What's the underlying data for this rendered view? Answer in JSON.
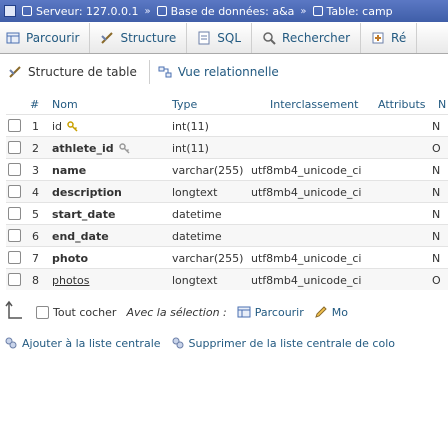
{
  "breadcrumb": {
    "server": "Serveur: 127.0.0.1",
    "database": "Base de données: a&a",
    "table": "Table: camp"
  },
  "tabs": [
    {
      "label": "Parcourir"
    },
    {
      "label": "Structure"
    },
    {
      "label": "SQL"
    },
    {
      "label": "Rechercher"
    },
    {
      "label": "Ré"
    }
  ],
  "subtabs": {
    "structure": "Structure de table",
    "relational": "Vue relationnelle"
  },
  "headers": {
    "num": "#",
    "name": "Nom",
    "type": "Type",
    "collation": "Interclassement",
    "attributes": "Attributs",
    "null": "N"
  },
  "rows": [
    {
      "num": "1",
      "name": "id",
      "type": "int(11)",
      "collation": "",
      "null": "N"
    },
    {
      "num": "2",
      "name": "athlete_id",
      "type": "int(11)",
      "collation": "",
      "null": "O"
    },
    {
      "num": "3",
      "name": "name",
      "type": "varchar(255)",
      "collation": "utf8mb4_unicode_ci",
      "null": "N"
    },
    {
      "num": "4",
      "name": "description",
      "type": "longtext",
      "collation": "utf8mb4_unicode_ci",
      "null": "N"
    },
    {
      "num": "5",
      "name": "start_date",
      "type": "datetime",
      "collation": "",
      "null": "N"
    },
    {
      "num": "6",
      "name": "end_date",
      "type": "datetime",
      "collation": "",
      "null": "N"
    },
    {
      "num": "7",
      "name": "photo",
      "type": "varchar(255)",
      "collation": "utf8mb4_unicode_ci",
      "null": "N"
    },
    {
      "num": "8",
      "name": "photos",
      "type": "longtext",
      "collation": "utf8mb4_unicode_ci",
      "null": "O"
    }
  ],
  "footer": {
    "check_all": "Tout cocher",
    "with_selection": "Avec la sélection :",
    "browse": "Parcourir",
    "modify": "Mo"
  },
  "central": {
    "add": "Ajouter à la liste centrale",
    "remove": "Supprimer de la liste centrale de colo"
  }
}
